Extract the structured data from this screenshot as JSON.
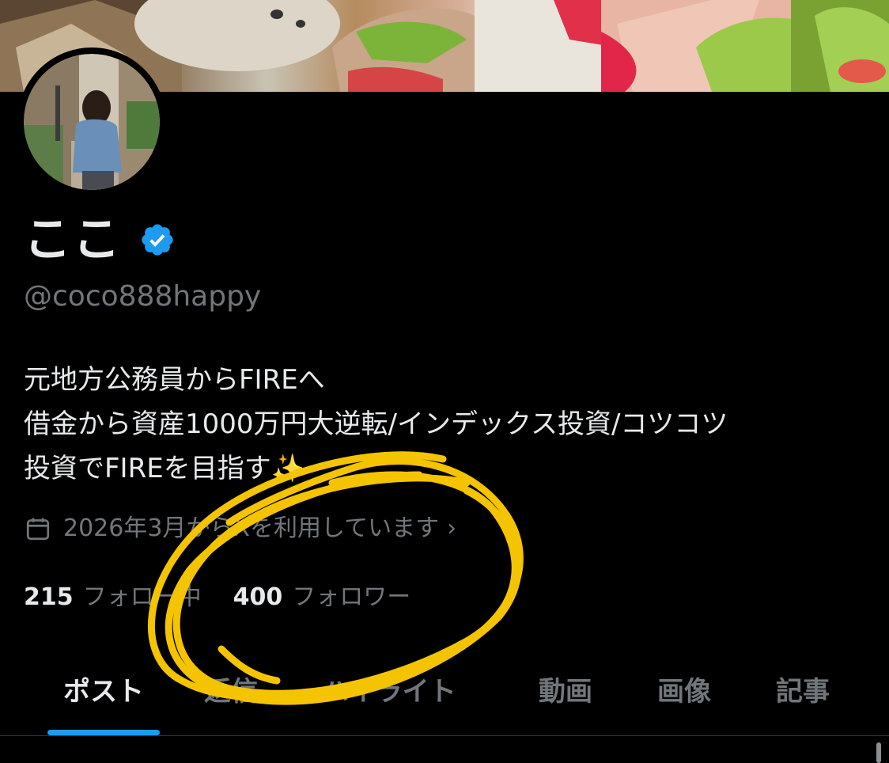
{
  "profile": {
    "display_name": "ここ",
    "handle": "@coco888happy",
    "bio_lines": [
      "元地方公務員からFIREへ",
      "借金から資産1000万円大逆転/インデックス投資/コツコツ",
      "投資でFIREを目指す✨"
    ],
    "joined": "2026年3月からXを利用しています",
    "following_count": "215",
    "following_label": "フォロー中",
    "followers_count": "400",
    "followers_label": "フォロワー",
    "verified_color": "#1d9bf0"
  },
  "tabs": [
    {
      "label": "ポスト",
      "active": true
    },
    {
      "label": "返信",
      "active": false
    },
    {
      "label": "ハイライト",
      "active": false
    },
    {
      "label": "動画",
      "active": false
    },
    {
      "label": "画像",
      "active": false
    },
    {
      "label": "記事",
      "active": false
    }
  ],
  "colors": {
    "accent": "#1d9bf0",
    "secondary_text": "#71767b",
    "annotation": "#f5c400"
  }
}
